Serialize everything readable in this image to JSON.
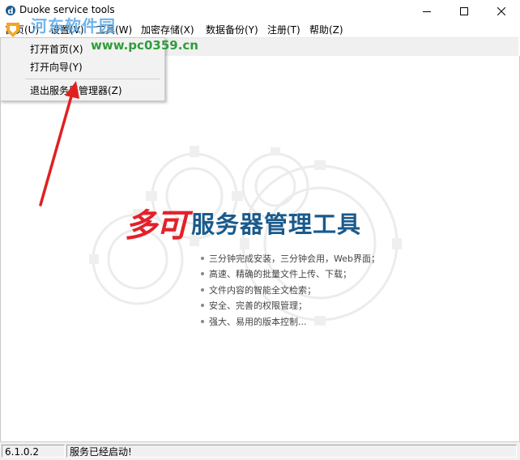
{
  "window": {
    "title": "Duoke service tools"
  },
  "watermark": {
    "site_name": "河东软件园",
    "url": "www.pc0359.cn"
  },
  "menubar": {
    "items": [
      {
        "label": "首页(U)"
      },
      {
        "label": "设置(V)"
      },
      {
        "label": "工具(W)"
      },
      {
        "label": "加密存储(X)"
      },
      {
        "label": "数据备份(Y)"
      },
      {
        "label": "注册(T)"
      },
      {
        "label": "帮助(Z)"
      }
    ]
  },
  "dropdown": {
    "items": [
      {
        "label": "打开首页(X)"
      },
      {
        "label": "打开向导(Y)"
      },
      {
        "label": "退出服务器管理器(Z)"
      }
    ]
  },
  "branding": {
    "logo_red": "多可",
    "logo_blue": "服务器管理工具",
    "features": [
      "三分钟完成安装，三分钟会用，Web界面；",
      "高速、精确的批量文件上传、下载；",
      "文件内容的智能全文检索；",
      "安全、完善的权限管理；",
      "强大、易用的版本控制..."
    ]
  },
  "statusbar": {
    "version": "6.1.0.2",
    "message": "服务已经启动!"
  },
  "colors": {
    "logo_red": "#e3212a",
    "logo_blue": "#1a5a8c",
    "arrow": "#e02020",
    "watermark_blue": "#5aa8e6",
    "watermark_green": "#2f9e3a"
  },
  "icons": {
    "app": "app-logo-icon",
    "minimize": "minimize-icon",
    "maximize": "maximize-icon",
    "close": "close-icon"
  }
}
